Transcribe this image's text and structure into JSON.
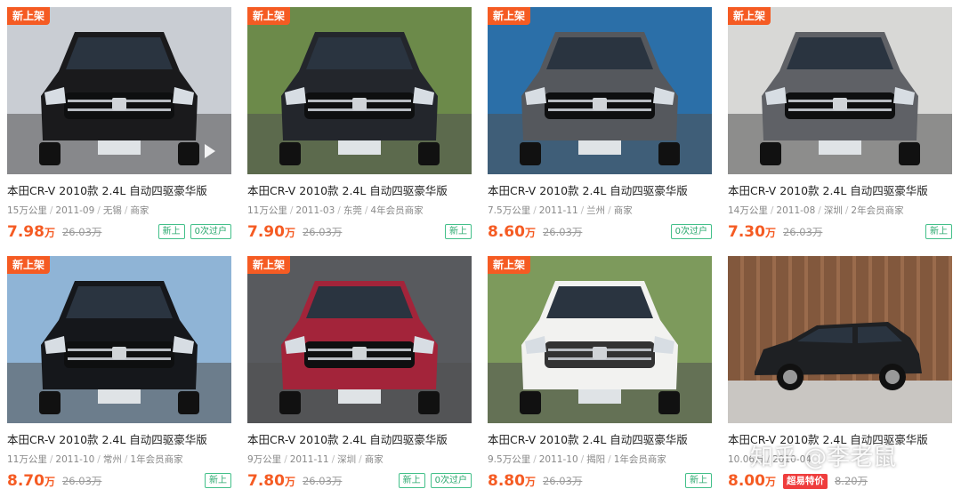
{
  "listings": [
    {
      "badge": "新上架",
      "title": "本田CR-V 2010款 2.4L 自动四驱豪华版",
      "mileage": "15万公里",
      "date": "2011-09",
      "city": "无锡",
      "seller": "商家",
      "price": "7.98",
      "unit": "万",
      "original": "26.03万",
      "tags": [
        "新上",
        "0次过户"
      ],
      "has_video": true,
      "color": "#1a1a1c",
      "bg": "#c9cdd3"
    },
    {
      "badge": "新上架",
      "title": "本田CR-V 2010款 2.4L 自动四驱豪华版",
      "mileage": "11万公里",
      "date": "2011-03",
      "city": "东莞",
      "seller": "4年会员商家",
      "price": "7.90",
      "unit": "万",
      "original": "26.03万",
      "tags": [
        "新上"
      ],
      "has_video": false,
      "color": "#23262c",
      "bg": "#6c8a4a"
    },
    {
      "badge": "新上架",
      "title": "本田CR-V 2010款 2.4L 自动四驱豪华版",
      "mileage": "7.5万公里",
      "date": "2011-11",
      "city": "兰州",
      "seller": "商家",
      "price": "8.60",
      "unit": "万",
      "original": "26.03万",
      "tags": [
        "0次过户"
      ],
      "has_video": false,
      "color": "#55585d",
      "bg": "#2b6fa8"
    },
    {
      "badge": "新上架",
      "title": "本田CR-V 2010款 2.4L 自动四驱豪华版",
      "mileage": "14万公里",
      "date": "2011-08",
      "city": "深圳",
      "seller": "2年会员商家",
      "price": "7.30",
      "unit": "万",
      "original": "26.03万",
      "tags": [
        "新上"
      ],
      "has_video": false,
      "color": "#5f6166",
      "bg": "#d8d8d6"
    },
    {
      "badge": "新上架",
      "title": "本田CR-V 2010款 2.4L 自动四驱豪华版",
      "mileage": "11万公里",
      "date": "2011-10",
      "city": "常州",
      "seller": "1年会员商家",
      "price": "8.70",
      "unit": "万",
      "original": "26.03万",
      "tags": [
        "新上"
      ],
      "has_video": false,
      "color": "#15171b",
      "bg": "#8fb4d6"
    },
    {
      "badge": "新上架",
      "title": "本田CR-V 2010款 2.4L 自动四驱豪华版",
      "mileage": "9万公里",
      "date": "2011-11",
      "city": "深圳",
      "seller": "商家",
      "price": "7.80",
      "unit": "万",
      "original": "26.03万",
      "tags": [
        "新上",
        "0次过户"
      ],
      "has_video": false,
      "color": "#a3243a",
      "bg": "#585a5e"
    },
    {
      "badge": "新上架",
      "title": "本田CR-V 2010款 2.4L 自动四驱豪华版",
      "mileage": "9.5万公里",
      "date": "2011-10",
      "city": "揭阳",
      "seller": "1年会员商家",
      "price": "8.80",
      "unit": "万",
      "original": "26.03万",
      "tags": [
        "新上"
      ],
      "has_video": false,
      "color": "#f2f2f0",
      "bg": "#7d9a5c"
    },
    {
      "badge": "",
      "title": "本田CR-V 2010款 2.4L 自动四驱豪华版",
      "mileage": "10.06万",
      "date": "2010-04",
      "city": "",
      "seller": "",
      "price": "8.00",
      "unit": "万",
      "original": "8.20万",
      "tags": [],
      "hot": "超易特价",
      "has_video": false,
      "color": "#1e2023",
      "bg": "#9a6b4c"
    }
  ],
  "watermark": "知乎 @李老鼠",
  "colors": {
    "accent": "#f55b23",
    "tag_green": "#2aa86e",
    "hot_red": "#ef3d3d"
  }
}
